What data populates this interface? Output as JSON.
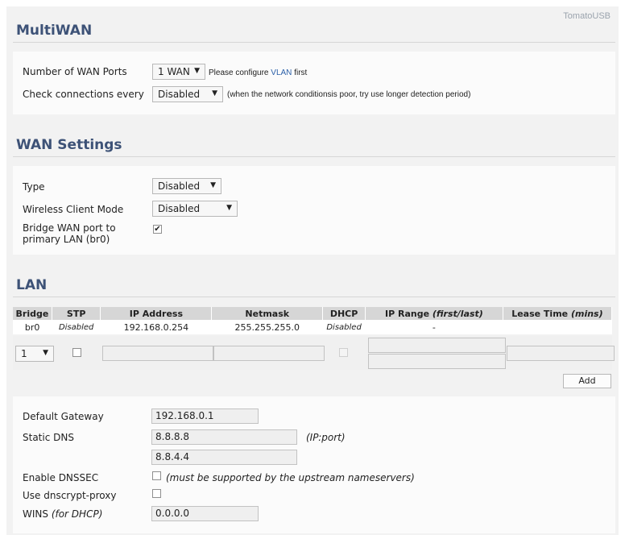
{
  "brand": "TomatoUSB",
  "sections": {
    "multiwan": "MultiWAN",
    "wan_settings": "WAN Settings",
    "lan": "LAN"
  },
  "multiwan": {
    "wan_ports_label": "Number of WAN Ports",
    "wan_ports_value": "1 WAN",
    "wan_ports_note_prefix": "Please configure",
    "wan_ports_note_link": "VLAN",
    "wan_ports_note_suffix": "first",
    "check_label": "Check connections every",
    "check_value": "Disabled",
    "check_note": "(when the network conditionsis poor, try use longer detection period)"
  },
  "wan": {
    "type_label": "Type",
    "type_value": "Disabled",
    "wcm_label": "Wireless Client Mode",
    "wcm_value": "Disabled",
    "bridge_label_line1": "Bridge WAN port to",
    "bridge_label_line2": "primary LAN (br0)",
    "bridge_checked": true
  },
  "lan_table": {
    "headers": {
      "bridge": "Bridge",
      "stp": "STP",
      "ip": "IP Address",
      "netmask": "Netmask",
      "dhcp": "DHCP",
      "range_prefix": "IP Range ",
      "range_italic": "(first/last)",
      "lease_prefix": "Lease Time ",
      "lease_italic": "(mins)"
    },
    "row": {
      "bridge": "br0",
      "stp": "Disabled",
      "ip": "192.168.0.254",
      "netmask": "255.255.255.0",
      "dhcp": "Disabled",
      "range": "-"
    },
    "new_row_bridge_value": "1",
    "add_label": "Add"
  },
  "lan_settings": {
    "gateway_label": "Default Gateway",
    "gateway_value": "192.168.0.1",
    "dns_label": "Static DNS",
    "dns1": "8.8.8.8",
    "dns2": "8.8.4.4",
    "dns_note": "(IP:port)",
    "dnssec_label": "Enable DNSSEC",
    "dnssec_note": "(must be supported by the upstream nameservers)",
    "dnscrypt_label": "Use dnscrypt-proxy",
    "wins_label": "WINS ",
    "wins_italic": "(for DHCP)",
    "wins_value": "0.0.0.0"
  }
}
